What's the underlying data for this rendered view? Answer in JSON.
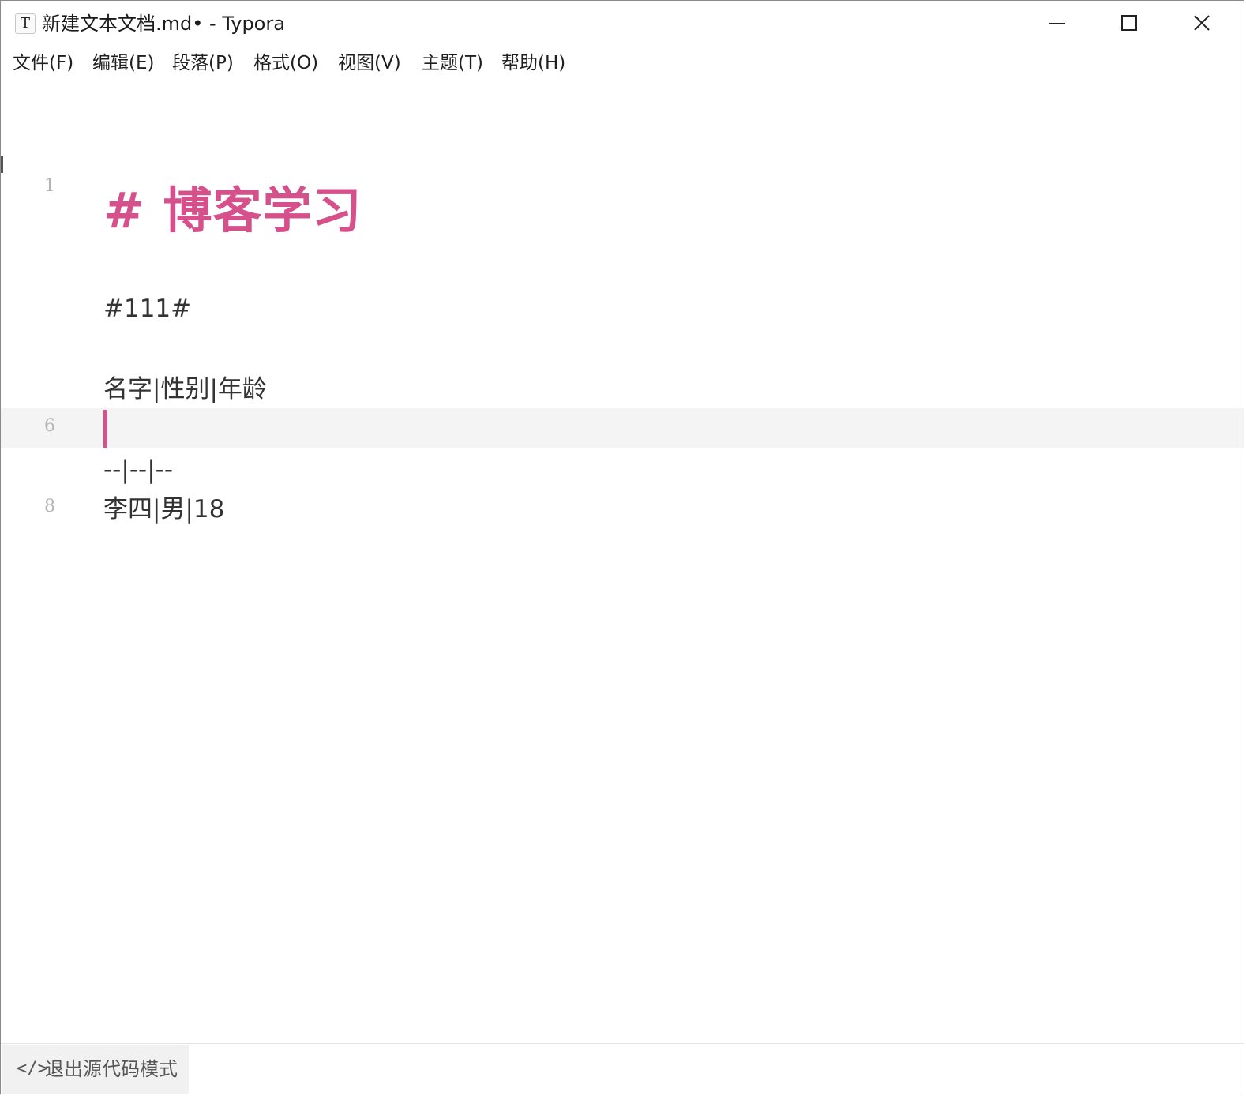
{
  "window": {
    "title": "新建文本文档.md• - Typora",
    "app_icon_glyph": "T",
    "controls": [
      "minimize-icon",
      "maximize-icon",
      "close-icon"
    ]
  },
  "menu": {
    "items": [
      {
        "label": "文件(F)"
      },
      {
        "label": "编辑(E)"
      },
      {
        "label": "段落(P)"
      },
      {
        "label": "格式(O)"
      },
      {
        "label": "视图(V)"
      },
      {
        "label": "主题(T)"
      },
      {
        "label": "帮助(H)"
      }
    ]
  },
  "editor": {
    "line_numbers": {
      "first": "1",
      "active": "6",
      "eighth": "8"
    },
    "lines": {
      "heading": "# 博客学习",
      "tag": "#111#",
      "table_header": "名字|性别|年龄",
      "table_sep": "--|--|--",
      "table_row": "李四|男|18"
    },
    "accent_color": "#d6518c"
  },
  "status": {
    "source_mode_icon": "</>",
    "source_mode_label": "退出源代码模式"
  }
}
